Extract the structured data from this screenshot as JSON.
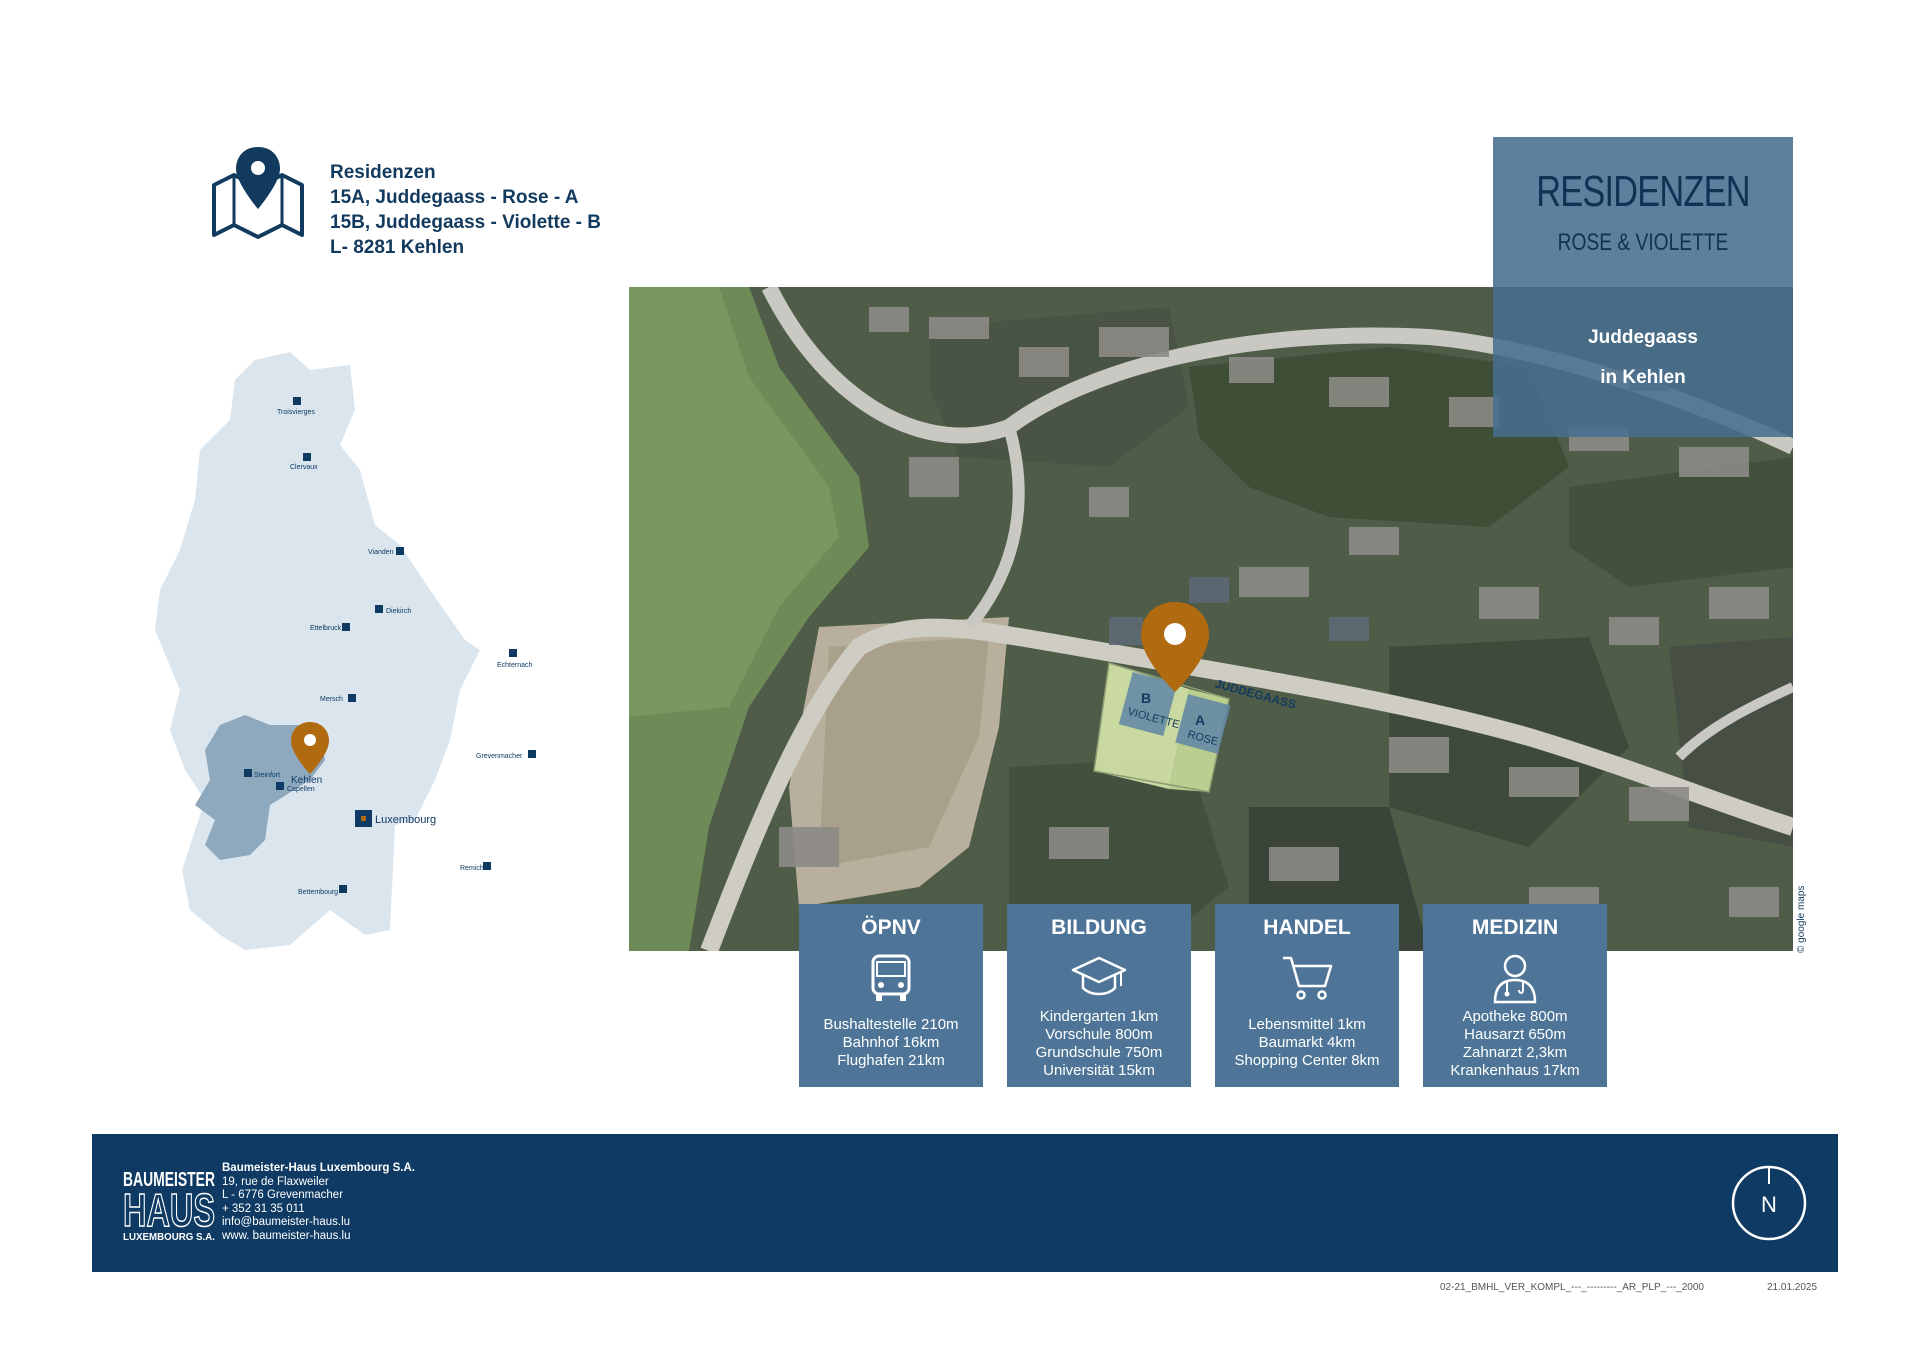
{
  "address": {
    "lines": [
      "Residenzen",
      "15A, Juddegaass - Rose - A",
      "15B, Juddegaass - Violette - B",
      "L- 8281 Kehlen"
    ]
  },
  "country_map": {
    "towns": [
      "Troisvierges",
      "Clervaux",
      "Vianden",
      "Diekirch",
      "Ettelbruck",
      "Echternach",
      "Mersch",
      "Steinfort",
      "Capellen",
      "Grevenmacher",
      "Remich",
      "Bettembourg"
    ],
    "capital": "Luxembourg",
    "project_town": "Kehlen"
  },
  "aerial": {
    "street_label": "JUDDEGAASS",
    "plot_b": {
      "letter": "B",
      "name": "VIOLETTE"
    },
    "plot_a": {
      "letter": "A",
      "name": "ROSE"
    },
    "copyright": "© google maps"
  },
  "title_box": {
    "title": "RESIDENZEN",
    "subtitle": "ROSE & VIOLETTE",
    "street": "Juddegaass",
    "town": "in Kehlen"
  },
  "cards": [
    {
      "heading": "ÖPNV",
      "icon": "bus-icon",
      "lines": [
        "Bushaltestelle 210m",
        "Bahnhof 16km",
        "Flughafen 21km"
      ]
    },
    {
      "heading": "BILDUNG",
      "icon": "graduation-cap-icon",
      "lines": [
        "Kindergarten 1km",
        "Vorschule 800m",
        "Grundschule 750m",
        "Universität 15km"
      ]
    },
    {
      "heading": "HANDEL",
      "icon": "shopping-cart-icon",
      "lines": [
        "Lebensmittel 1km",
        "Baumarkt 4km",
        "Shopping Center 8km"
      ]
    },
    {
      "heading": "MEDIZIN",
      "icon": "doctor-icon",
      "lines": [
        "Apotheke 800m",
        "Hausarzt 650m",
        "Zahnarzt 2,3km",
        "Krankenhaus 17km"
      ]
    }
  ],
  "footer": {
    "logo_lines": [
      "BAUMEISTER",
      "HAUS",
      "LUXEMBOURG S.A."
    ],
    "company_name": "Baumeister-Haus Luxembourg S.A.",
    "street": "19, rue de Flaxweiler",
    "city": "L - 6776 Grevenmacher",
    "phone": "+ 352 31 35 011",
    "email": "info@baumeister-haus.lu",
    "web": "www. baumeister-haus.lu",
    "north": "N"
  },
  "doc_ref": "02-21_BMHL_VER_KOMPL_---_---------_AR_PLP_---_2000",
  "doc_date": "21.01.2025",
  "colors": {
    "navy": "#0e3a63",
    "slate": "#4e7597",
    "pin": "#b06a10",
    "map_light": "#dbe5ee",
    "map_region": "#8ea8bd"
  }
}
